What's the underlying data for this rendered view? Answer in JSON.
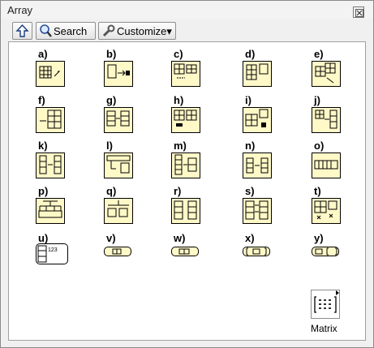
{
  "window": {
    "title": "Array",
    "close_glyph": "⊠"
  },
  "toolbar": {
    "up_icon": "up-arrow-icon",
    "search_label": "Search",
    "customize_label": "Customize▾"
  },
  "palette": {
    "items": [
      {
        "letter": "a)"
      },
      {
        "letter": "b)"
      },
      {
        "letter": "c)"
      },
      {
        "letter": "d)"
      },
      {
        "letter": "e)"
      },
      {
        "letter": "f)"
      },
      {
        "letter": "g)"
      },
      {
        "letter": "h)"
      },
      {
        "letter": "i)"
      },
      {
        "letter": "j)"
      },
      {
        "letter": "k)"
      },
      {
        "letter": "l)"
      },
      {
        "letter": "m)"
      },
      {
        "letter": "n)"
      },
      {
        "letter": "o)"
      },
      {
        "letter": "p)"
      },
      {
        "letter": "q)"
      },
      {
        "letter": "r)"
      },
      {
        "letter": "s)"
      },
      {
        "letter": "t)"
      },
      {
        "letter": "u)"
      },
      {
        "letter": "v)"
      },
      {
        "letter": "w)"
      },
      {
        "letter": "x)"
      },
      {
        "letter": "y)"
      }
    ],
    "matrix_label": "Matrix"
  },
  "colors": {
    "icon_fill": "#fff9c8",
    "panel_bg": "#ffffff",
    "window_bg": "#f0f0f0"
  }
}
